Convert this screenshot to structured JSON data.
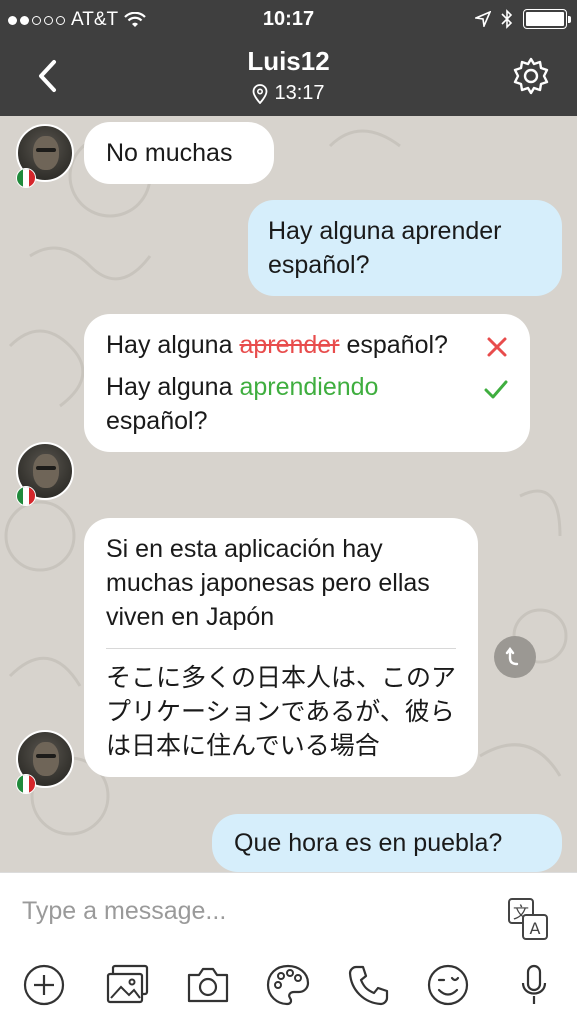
{
  "status_bar": {
    "carrier": "AT&T",
    "time": "10:17",
    "signal_filled": 2,
    "signal_total": 5,
    "battery_level": 1.0
  },
  "nav": {
    "title": "Luis12",
    "local_time": "13:17"
  },
  "messages": [
    {
      "direction": "in",
      "text": "No muchas"
    },
    {
      "direction": "out",
      "text": "Hay alguna aprender español?"
    },
    {
      "direction": "in",
      "type": "correction",
      "original": {
        "before": "Hay alguna ",
        "wrong": "aprender",
        "after": " español?"
      },
      "corrected": {
        "before": "Hay alguna ",
        "right": "aprendiendo",
        "after": " español?"
      }
    },
    {
      "direction": "in",
      "type": "translated",
      "text": "Si en esta aplicación hay muchas japonesas pero ellas viven en Japón",
      "translation": "そこに多くの日本人は、このアプリケーションであるが、彼らは日本に住んでいる場合"
    },
    {
      "direction": "out",
      "text": "Que hora es en puebla?"
    }
  ],
  "composer": {
    "placeholder": "Type a message..."
  },
  "icons": {
    "back": "chevron-left-icon",
    "settings": "gear-icon",
    "location": "location-pin-icon",
    "translate": "translate-icon",
    "toolbar": [
      "plus-icon",
      "gallery-icon",
      "camera-icon",
      "palette-icon",
      "phone-icon",
      "emoji-icon",
      "microphone-icon"
    ]
  },
  "colors": {
    "header": "#3f3f3f",
    "outgoing_bubble": "#d6eefb",
    "incoming_bubble": "#ffffff",
    "wrong": "#e84c4c",
    "right": "#3fae3f"
  }
}
